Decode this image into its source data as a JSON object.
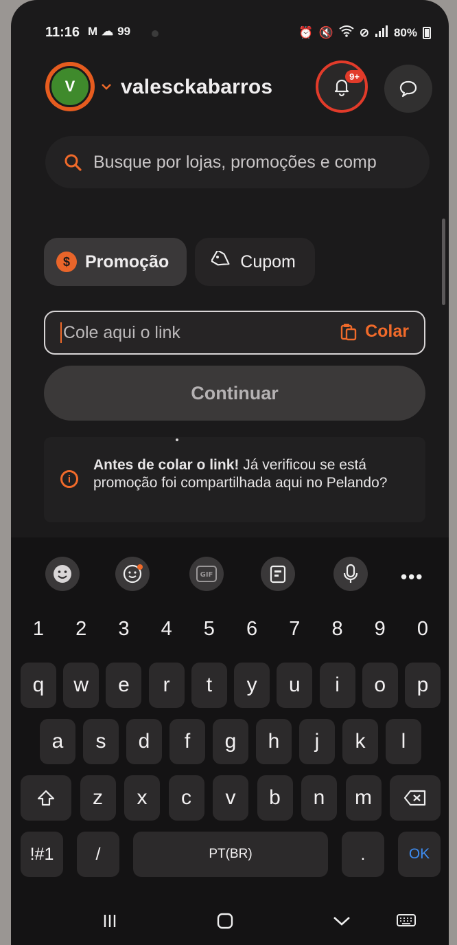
{
  "status_bar": {
    "time": "11:16",
    "left_icons": [
      "M",
      "99"
    ],
    "battery_text": "80%"
  },
  "header": {
    "avatar_initial": "V",
    "username": "valesckabarros",
    "notification_badge": "9+"
  },
  "search": {
    "placeholder": "Busque por lojas, promoções e comp"
  },
  "post_type_tabs": [
    {
      "label": "Promoção",
      "icon": "promo-icon",
      "selected": true
    },
    {
      "label": "Cupom",
      "icon": "tag-icon",
      "selected": false
    }
  ],
  "link_field": {
    "placeholder": "Cole aqui o link",
    "paste_label": "Colar"
  },
  "continue_label": "Continuar",
  "notice": {
    "bold": "Antes de colar o link!",
    "text": " Já verificou se está promoção foi compartilhada aqui no Pelando?"
  },
  "keyboard": {
    "toolbar": [
      "emoji-icon",
      "sticker-icon",
      "gif-icon",
      "clipboard-icon",
      "microphone-icon",
      "more-icon"
    ],
    "number_row": [
      "1",
      "2",
      "3",
      "4",
      "5",
      "6",
      "7",
      "8",
      "9",
      "0"
    ],
    "row1": [
      "q",
      "w",
      "e",
      "r",
      "t",
      "y",
      "u",
      "i",
      "o",
      "p"
    ],
    "row2": [
      "a",
      "s",
      "d",
      "f",
      "g",
      "h",
      "j",
      "k",
      "l"
    ],
    "row3": [
      "z",
      "x",
      "c",
      "v",
      "b",
      "n",
      "m"
    ],
    "symbols_label": "!#1",
    "slash_label": "/",
    "space_label": "PT(BR)",
    "period_label": ".",
    "ok_label": "OK",
    "more_label": "•••"
  },
  "colors": {
    "accent": "#f06a2a",
    "alert": "#e23b2a",
    "ok_key": "#3e8cf0"
  }
}
